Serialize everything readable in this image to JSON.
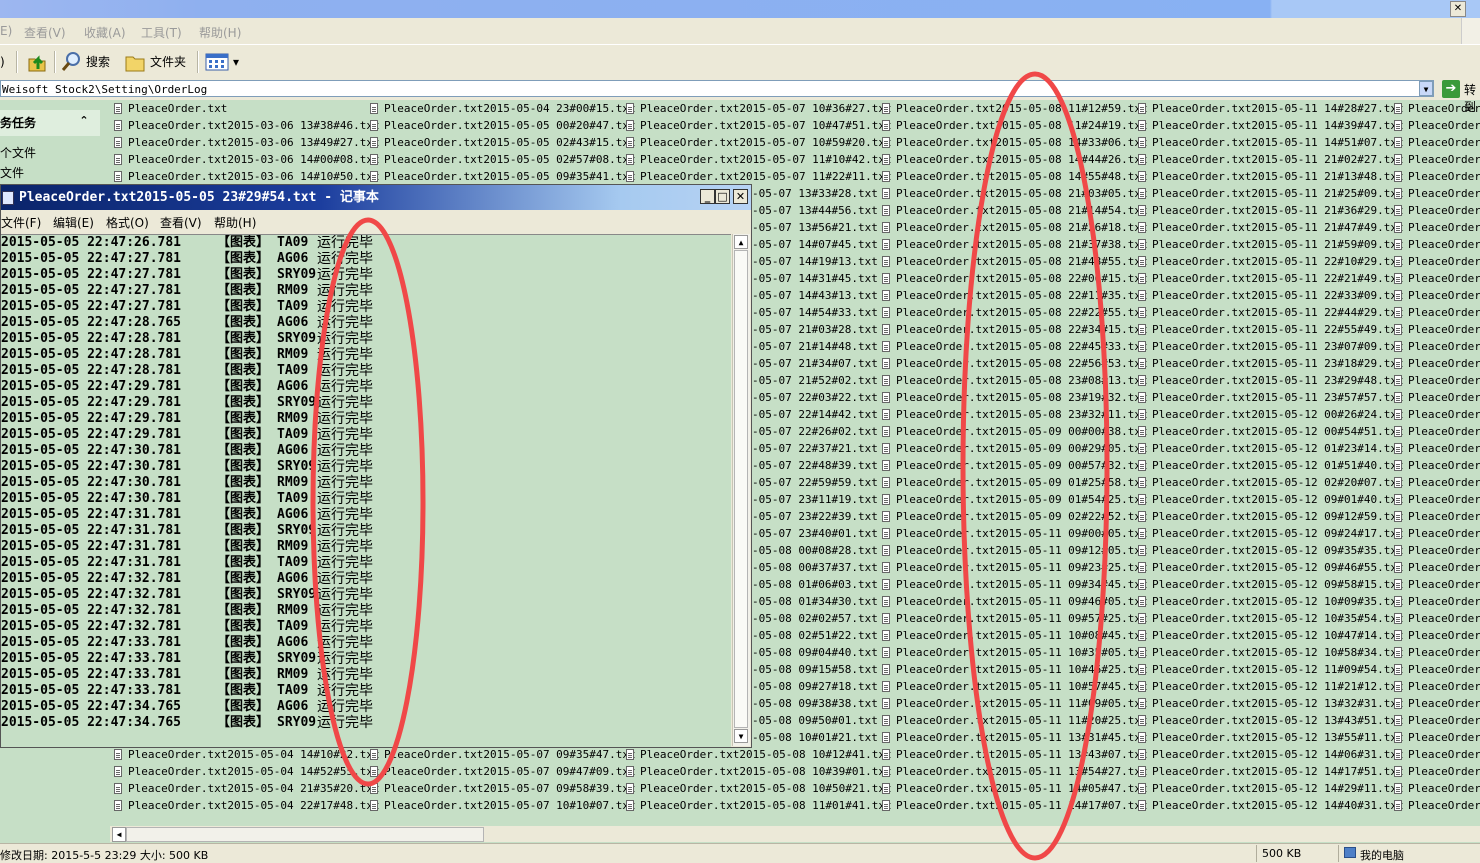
{
  "menubar": {
    "items": [
      "E)",
      "查看(V)",
      "收藏(A)",
      "工具(T)",
      "帮助(H)"
    ]
  },
  "toolbar": {
    "search_label": "搜索",
    "folders_label": "文件夹",
    "views_label": "▾"
  },
  "address": {
    "path": "Weisoft Stock2\\Setting\\OrderLog",
    "go_label": "转到"
  },
  "taskpane": {
    "title": "务任务",
    "chevron": "⌃",
    "links": [
      "个文件",
      "文件"
    ]
  },
  "statusbar": {
    "left": "修改日期: 2015-5-5 23:29 大小: 500 KB",
    "size": "500 KB",
    "location": "我的电脑"
  },
  "notepad": {
    "title": "PleaceOrder.txt2015-05-05 23#29#54.txt - 记事本",
    "menu": [
      "文件(F)",
      "编辑(E)",
      "格式(O)",
      "查看(V)",
      "帮助(H)"
    ],
    "buttons": {
      "minimize": "_",
      "maximize": "□",
      "close": "✕"
    },
    "lines": [
      {
        "ts": "2015-05-05 22:47:26.781",
        "tag": "【图表】",
        "sym": "TA09",
        "msg": "运行完毕"
      },
      {
        "ts": "2015-05-05 22:47:27.781",
        "tag": "【图表】",
        "sym": "AG06",
        "msg": "运行完毕"
      },
      {
        "ts": "2015-05-05 22:47:27.781",
        "tag": "【图表】",
        "sym": "SRY09",
        "msg": "运行完毕"
      },
      {
        "ts": "2015-05-05 22:47:27.781",
        "tag": "【图表】",
        "sym": "RM09",
        "msg": "运行完毕"
      },
      {
        "ts": "2015-05-05 22:47:27.781",
        "tag": "【图表】",
        "sym": "TA09",
        "msg": "运行完毕"
      },
      {
        "ts": "2015-05-05 22:47:28.765",
        "tag": "【图表】",
        "sym": "AG06",
        "msg": "运行完毕"
      },
      {
        "ts": "2015-05-05 22:47:28.781",
        "tag": "【图表】",
        "sym": "SRY09",
        "msg": "运行完毕"
      },
      {
        "ts": "2015-05-05 22:47:28.781",
        "tag": "【图表】",
        "sym": "RM09",
        "msg": "运行完毕"
      },
      {
        "ts": "2015-05-05 22:47:28.781",
        "tag": "【图表】",
        "sym": "TA09",
        "msg": "运行完毕"
      },
      {
        "ts": "2015-05-05 22:47:29.781",
        "tag": "【图表】",
        "sym": "AG06",
        "msg": "运行完毕"
      },
      {
        "ts": "2015-05-05 22:47:29.781",
        "tag": "【图表】",
        "sym": "SRY09",
        "msg": "运行完毕"
      },
      {
        "ts": "2015-05-05 22:47:29.781",
        "tag": "【图表】",
        "sym": "RM09",
        "msg": "运行完毕"
      },
      {
        "ts": "2015-05-05 22:47:29.781",
        "tag": "【图表】",
        "sym": "TA09",
        "msg": "运行完毕"
      },
      {
        "ts": "2015-05-05 22:47:30.781",
        "tag": "【图表】",
        "sym": "AG06",
        "msg": "运行完毕"
      },
      {
        "ts": "2015-05-05 22:47:30.781",
        "tag": "【图表】",
        "sym": "SRY09",
        "msg": "运行完毕"
      },
      {
        "ts": "2015-05-05 22:47:30.781",
        "tag": "【图表】",
        "sym": "RM09",
        "msg": "运行完毕"
      },
      {
        "ts": "2015-05-05 22:47:30.781",
        "tag": "【图表】",
        "sym": "TA09",
        "msg": "运行完毕"
      },
      {
        "ts": "2015-05-05 22:47:31.781",
        "tag": "【图表】",
        "sym": "AG06",
        "msg": "运行完毕"
      },
      {
        "ts": "2015-05-05 22:47:31.781",
        "tag": "【图表】",
        "sym": "SRY09",
        "msg": "运行完毕"
      },
      {
        "ts": "2015-05-05 22:47:31.781",
        "tag": "【图表】",
        "sym": "RM09",
        "msg": "运行完毕"
      },
      {
        "ts": "2015-05-05 22:47:31.781",
        "tag": "【图表】",
        "sym": "TA09",
        "msg": "运行完毕"
      },
      {
        "ts": "2015-05-05 22:47:32.781",
        "tag": "【图表】",
        "sym": "AG06",
        "msg": "运行完毕"
      },
      {
        "ts": "2015-05-05 22:47:32.781",
        "tag": "【图表】",
        "sym": "SRY09",
        "msg": "运行完毕"
      },
      {
        "ts": "2015-05-05 22:47:32.781",
        "tag": "【图表】",
        "sym": "RM09",
        "msg": "运行完毕"
      },
      {
        "ts": "2015-05-05 22:47:32.781",
        "tag": "【图表】",
        "sym": "TA09",
        "msg": "运行完毕"
      },
      {
        "ts": "2015-05-05 22:47:33.781",
        "tag": "【图表】",
        "sym": "AG06",
        "msg": "运行完毕"
      },
      {
        "ts": "2015-05-05 22:47:33.781",
        "tag": "【图表】",
        "sym": "SRY09",
        "msg": "运行完毕"
      },
      {
        "ts": "2015-05-05 22:47:33.781",
        "tag": "【图表】",
        "sym": "RM09",
        "msg": "运行完毕"
      },
      {
        "ts": "2015-05-05 22:47:33.781",
        "tag": "【图表】",
        "sym": "TA09",
        "msg": "运行完毕"
      },
      {
        "ts": "2015-05-05 22:47:34.765",
        "tag": "【图表】",
        "sym": "AG06",
        "msg": "运行完毕"
      },
      {
        "ts": "2015-05-05 22:47:34.765",
        "tag": "【图表】",
        "sym": "SRY09",
        "msg": "运行完毕"
      }
    ]
  },
  "files": {
    "col1": [
      "PleaceOrder.txt",
      "PleaceOrder.txt2015-03-06 13#38#46.txt",
      "PleaceOrder.txt2015-03-06 13#49#27.txt",
      "PleaceOrder.txt2015-03-06 14#00#08.txt",
      "PleaceOrder.txt2015-03-06 14#10#50.txt"
    ],
    "col1_bottom": [
      "PleaceOrder.txt2015-05-04 14#10#22.txt",
      "PleaceOrder.txt2015-05-04 14#52#55.txt",
      "PleaceOrder.txt2015-05-04 21#35#20.txt",
      "PleaceOrder.txt2015-05-04 22#17#48.txt"
    ],
    "col2": [
      "PleaceOrder.txt2015-05-04 23#00#15.txt",
      "PleaceOrder.txt2015-05-05 00#20#47.txt",
      "PleaceOrder.txt2015-05-05 02#43#15.txt",
      "PleaceOrder.txt2015-05-05 02#57#08.txt",
      "PleaceOrder.txt2015-05-05 09#35#41.txt"
    ],
    "col2_bottom": [
      "PleaceOrder.txt2015-05-07 09#35#47.txt",
      "PleaceOrder.txt2015-05-07 09#47#09.txt",
      "PleaceOrder.txt2015-05-07 09#58#39.txt",
      "PleaceOrder.txt2015-05-07 10#10#07.txt"
    ],
    "col3_top": [
      "PleaceOrder.txt2015-05-07 10#36#27.txt",
      "PleaceOrder.txt2015-05-07 10#47#51.txt",
      "PleaceOrder.txt2015-05-07 10#59#20.txt",
      "PleaceOrder.txt2015-05-07 11#10#42.txt",
      "PleaceOrder.txt2015-05-07 11#22#11.txt"
    ],
    "col3_partial": [
      "-05-07 13#33#28.txt",
      "-05-07 13#44#56.txt",
      "-05-07 13#56#21.txt",
      "-05-07 14#07#45.txt",
      "-05-07 14#19#13.txt",
      "-05-07 14#31#45.txt",
      "-05-07 14#43#13.txt",
      "-05-07 14#54#33.txt",
      "-05-07 21#03#28.txt",
      "-05-07 21#14#48.txt",
      "-05-07 21#34#07.txt",
      "-05-07 21#52#02.txt",
      "-05-07 22#03#22.txt",
      "-05-07 22#14#42.txt",
      "-05-07 22#26#02.txt",
      "-05-07 22#37#21.txt",
      "-05-07 22#48#39.txt",
      "-05-07 22#59#59.txt",
      "-05-07 23#11#19.txt",
      "-05-07 23#22#39.txt",
      "-05-07 23#40#01.txt",
      "-05-08 00#08#28.txt",
      "-05-08 00#37#37.txt",
      "-05-08 01#06#03.txt",
      "-05-08 01#34#30.txt",
      "-05-08 02#02#57.txt",
      "-05-08 02#51#22.txt",
      "-05-08 09#04#40.txt",
      "-05-08 09#15#58.txt",
      "-05-08 09#27#18.txt",
      "-05-08 09#38#38.txt",
      "-05-08 09#50#01.txt",
      "-05-08 10#01#21.txt"
    ],
    "col3_bottom": [
      "PleaceOrder.txt2015-05-08 10#12#41.txt",
      "PleaceOrder.txt2015-05-08 10#39#01.txt",
      "PleaceOrder.txt2015-05-08 10#50#21.txt",
      "PleaceOrder.txt2015-05-08 11#01#41.txt"
    ],
    "col4": [
      "PleaceOrder.txt2015-05-08 11#12#59.txt",
      "PleaceOrder.txt2015-05-08 11#24#19.txt",
      "PleaceOrder.txt2015-05-08 14#33#06.txt",
      "PleaceOrder.txt2015-05-08 14#44#26.txt",
      "PleaceOrder.txt2015-05-08 14#55#48.txt",
      "PleaceOrder.txt2015-05-08 21#03#05.txt",
      "PleaceOrder.txt2015-05-08 21#14#54.txt",
      "PleaceOrder.txt2015-05-08 21#26#18.txt",
      "PleaceOrder.txt2015-05-08 21#37#38.txt",
      "PleaceOrder.txt2015-05-08 21#48#55.txt",
      "PleaceOrder.txt2015-05-08 22#00#15.txt",
      "PleaceOrder.txt2015-05-08 22#11#35.txt",
      "PleaceOrder.txt2015-05-08 22#22#55.txt",
      "PleaceOrder.txt2015-05-08 22#34#15.txt",
      "PleaceOrder.txt2015-05-08 22#45#33.txt",
      "PleaceOrder.txt2015-05-08 22#56#53.txt",
      "PleaceOrder.txt2015-05-08 23#08#13.txt",
      "PleaceOrder.txt2015-05-08 23#19#32.txt",
      "PleaceOrder.txt2015-05-08 23#32#11.txt",
      "PleaceOrder.txt2015-05-09 00#00#38.txt",
      "PleaceOrder.txt2015-05-09 00#29#05.txt",
      "PleaceOrder.txt2015-05-09 00#57#32.txt",
      "PleaceOrder.txt2015-05-09 01#25#58.txt",
      "PleaceOrder.txt2015-05-09 01#54#25.txt",
      "PleaceOrder.txt2015-05-09 02#22#52.txt",
      "PleaceOrder.txt2015-05-11 09#00#05.txt",
      "PleaceOrder.txt2015-05-11 09#12#05.txt",
      "PleaceOrder.txt2015-05-11 09#23#25.txt",
      "PleaceOrder.txt2015-05-11 09#34#45.txt",
      "PleaceOrder.txt2015-05-11 09#46#05.txt",
      "PleaceOrder.txt2015-05-11 09#57#25.txt",
      "PleaceOrder.txt2015-05-11 10#08#45.txt",
      "PleaceOrder.txt2015-05-11 10#35#05.txt",
      "PleaceOrder.txt2015-05-11 10#46#25.txt",
      "PleaceOrder.txt2015-05-11 10#57#45.txt",
      "PleaceOrder.txt2015-05-11 11#09#05.txt",
      "PleaceOrder.txt2015-05-11 11#20#25.txt",
      "PleaceOrder.txt2015-05-11 13#31#45.txt",
      "PleaceOrder.txt2015-05-11 13#43#07.txt",
      "PleaceOrder.txt2015-05-11 13#54#27.txt",
      "PleaceOrder.txt2015-05-11 14#05#47.txt",
      "PleaceOrder.txt2015-05-11 14#17#07.txt"
    ],
    "col5": [
      "PleaceOrder.txt2015-05-11 14#28#27.txt",
      "PleaceOrder.txt2015-05-11 14#39#47.txt",
      "PleaceOrder.txt2015-05-11 14#51#07.txt",
      "PleaceOrder.txt2015-05-11 21#02#27.txt",
      "PleaceOrder.txt2015-05-11 21#13#48.txt",
      "PleaceOrder.txt2015-05-11 21#25#09.txt",
      "PleaceOrder.txt2015-05-11 21#36#29.txt",
      "PleaceOrder.txt2015-05-11 21#47#49.txt",
      "PleaceOrder.txt2015-05-11 21#59#09.txt",
      "PleaceOrder.txt2015-05-11 22#10#29.txt",
      "PleaceOrder.txt2015-05-11 22#21#49.txt",
      "PleaceOrder.txt2015-05-11 22#33#09.txt",
      "PleaceOrder.txt2015-05-11 22#44#29.txt",
      "PleaceOrder.txt2015-05-11 22#55#49.txt",
      "PleaceOrder.txt2015-05-11 23#07#09.txt",
      "PleaceOrder.txt2015-05-11 23#18#29.txt",
      "PleaceOrder.txt2015-05-11 23#29#48.txt",
      "PleaceOrder.txt2015-05-11 23#57#57.txt",
      "PleaceOrder.txt2015-05-12 00#26#24.txt",
      "PleaceOrder.txt2015-05-12 00#54#51.txt",
      "PleaceOrder.txt2015-05-12 01#23#14.txt",
      "PleaceOrder.txt2015-05-12 01#51#40.txt",
      "PleaceOrder.txt2015-05-12 02#20#07.txt",
      "PleaceOrder.txt2015-05-12 09#01#40.txt",
      "PleaceOrder.txt2015-05-12 09#12#59.txt",
      "PleaceOrder.txt2015-05-12 09#24#17.txt",
      "PleaceOrder.txt2015-05-12 09#35#35.txt",
      "PleaceOrder.txt2015-05-12 09#46#55.txt",
      "PleaceOrder.txt2015-05-12 09#58#15.txt",
      "PleaceOrder.txt2015-05-12 10#09#35.txt",
      "PleaceOrder.txt2015-05-12 10#35#54.txt",
      "PleaceOrder.txt2015-05-12 10#47#14.txt",
      "PleaceOrder.txt2015-05-12 10#58#34.txt",
      "PleaceOrder.txt2015-05-12 11#09#54.txt",
      "PleaceOrder.txt2015-05-12 11#21#12.txt",
      "PleaceOrder.txt2015-05-12 13#32#31.txt",
      "PleaceOrder.txt2015-05-12 13#43#51.txt",
      "PleaceOrder.txt2015-05-12 13#55#11.txt",
      "PleaceOrder.txt2015-05-12 14#06#31.txt",
      "PleaceOrder.txt2015-05-12 14#17#51.txt",
      "PleaceOrder.txt2015-05-12 14#29#11.txt",
      "PleaceOrder.txt2015-05-12 14#40#31.txt"
    ],
    "col6": "PleaceOrder."
  },
  "colors": {
    "background": "#c6dfc6",
    "annotation": "#f04848"
  }
}
